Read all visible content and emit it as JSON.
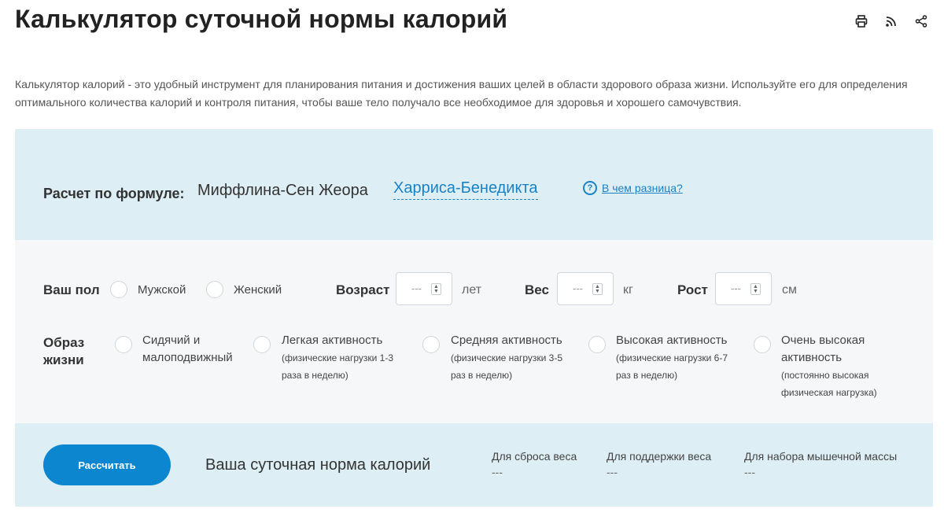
{
  "page_title": "Калькулятор суточной нормы калорий",
  "header_icons": [
    "print-icon",
    "rss-icon",
    "share-icon"
  ],
  "intro": "Калькулятор калорий - это удобный инструмент для планирования питания и достижения ваших целей в области здорового образа жизни. Используйте его для определения оптимального количества калорий и контроля питания, чтобы ваше тело получало все необходимое для здоровья и хорошего самочувствия.",
  "formula": {
    "label": "Расчет по формуле:",
    "option1": "Миффлина-Сен Жеора",
    "option2": "Харриса-Бенедикта",
    "diff_link": "В чем разница?",
    "diff_icon_glyph": "?"
  },
  "gender": {
    "label": "Ваш пол",
    "male": "Мужской",
    "female": "Женский"
  },
  "age": {
    "label": "Возраст",
    "placeholder": "---",
    "unit": "лет"
  },
  "weight": {
    "label": "Вес",
    "placeholder": "---",
    "unit": "кг"
  },
  "height": {
    "label": "Рост",
    "placeholder": "---",
    "unit": "см"
  },
  "lifestyle": {
    "label_line1": "Образ",
    "label_line2": "жизни",
    "options": [
      {
        "title": "Сидячий и малоподвижный",
        "sub": ""
      },
      {
        "title": "Легкая активность",
        "sub": "(физические нагрузки 1-3 раза в неделю)"
      },
      {
        "title": "Средняя активность",
        "sub": "(физические нагрузки 3-5 раз в неделю)"
      },
      {
        "title": "Высокая активность",
        "sub": "(физические нагрузки 6-7 раз в неделю)"
      },
      {
        "title": "Очень высокая активность",
        "sub": "(постоянно высокая физическая нагрузка)"
      }
    ]
  },
  "result": {
    "button": "Рассчитать",
    "title": "Ваша суточная норма калорий",
    "loss_label": "Для сброса веса",
    "loss_value": "---",
    "maintain_label": "Для поддержки веса",
    "maintain_value": "---",
    "gain_label": "Для набора мышечной массы",
    "gain_value": "---"
  },
  "colors": {
    "accent": "#1a82c4",
    "button": "#0b86cf",
    "panel_blue": "#ddeef4",
    "panel_gray": "#f5f7f9"
  }
}
